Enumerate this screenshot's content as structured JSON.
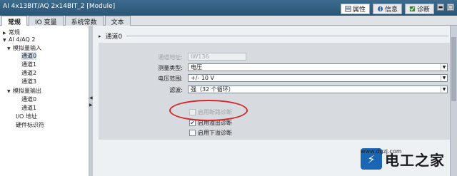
{
  "titlebar": {
    "title": "AI 4x13BIT/AQ 2x14BIT_2 [Module]"
  },
  "right_tabs": [
    {
      "label": "属性",
      "icon": "properties-icon"
    },
    {
      "label": "信息",
      "icon": "info-icon"
    },
    {
      "label": "诊断",
      "icon": "diagnostics-icon"
    }
  ],
  "tabs": [
    "常规",
    "IO 变量",
    "系统常数",
    "文本"
  ],
  "tree": {
    "root": "常规",
    "module": "AI 4/AQ 2",
    "ai_group": "模拟量输入",
    "ai_ch": [
      "通道0",
      "通道1",
      "通道2",
      "通道3"
    ],
    "aq_group": "模拟量输出",
    "aq_ch": [
      "通道0",
      "通道1"
    ],
    "io_addr": "I/O 地址",
    "hw_id": "硬件标识符"
  },
  "section": {
    "title": "通道0"
  },
  "form": {
    "channel_address": {
      "label": "通道地址:",
      "value": "IW136"
    },
    "measure_type": {
      "label": "测量类型:",
      "value": "电压"
    },
    "voltage_range": {
      "label": "电压范围:",
      "value": "+/- 10 V"
    },
    "filter": {
      "label": "滤波:",
      "value": "强（32 个循环）"
    },
    "wire_break": {
      "label": "启用断路诊断",
      "checked": false,
      "disabled": true
    },
    "overflow": {
      "label": "启用溢出诊断",
      "checked": true
    },
    "underflow": {
      "label": "启用下溢诊断",
      "checked": false
    }
  },
  "watermark": {
    "brand": "电工之家",
    "url": "www.dgzj.com"
  },
  "colors": {
    "annotation": "#d72525",
    "accent": "#1a66b5"
  }
}
